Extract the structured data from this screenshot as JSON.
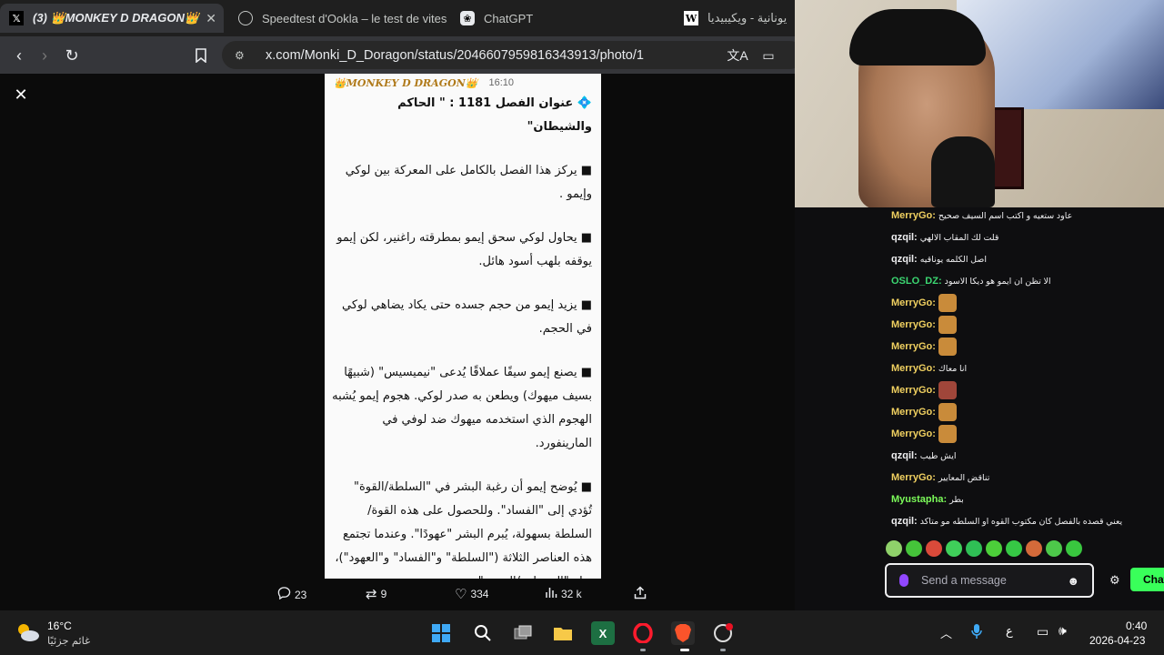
{
  "browser": {
    "tabs": [
      {
        "title": "(3) 👑MONKEY D DRAGON👑",
        "favicon": "x-logo-icon"
      },
      {
        "title": "Speedtest d'Ookla – le test de vitesse",
        "favicon": "speedtest-icon"
      },
      {
        "title": "ChatGPT",
        "favicon": "chatgpt-icon"
      },
      {
        "title": "يونانية - ويكيبيديا",
        "favicon": "wikipedia-icon"
      }
    ],
    "url": "x.com/Monki_D_Doragon/status/2046607959816343913/photo/1"
  },
  "photo": {
    "header_name": "👑MONKEY D DRAGON👑",
    "header_time": "16:10",
    "title": "💠 عنوان الفصل 1181 : \" الحاكم والشيطان\"",
    "paragraphs": [
      "■ يركز هذا الفصل بالكامل على المعركة بين لوكي وإيمو .",
      "■ يحاول لوكي سحق إيمو بمطرقته راغنير، لكن إيمو يوقفه بلهب أسود هائل.",
      "■ يزيد إيمو من حجم جسده حتى يكاد يضاهي لوكي في الحجم.",
      "■ يصنع إيمو سيفًا عملاقًا يُدعى \"نيميسيس\" (شبيهًا بسيف ميهوك) ويطعن به صدر لوكي. هجوم إيمو يُشبه الهجوم الذي استخدمه ميهوك ضد لوفي في المارينفورد.",
      "■ يُوضح إيمو أن رغبة البشر في \"السلطة/القوة\" تُؤدي إلى \"الفساد\". وللحصول على هذه القوة/ السلطة بسهولة، يُبرم البشر \"عهودًا\". وعندما تجتمع هذه العناصر الثلاثة (\"السلطة\" و\"الفساد\" و\"العهود\")، يولد \"السيطرة/الهيمنة\"."
    ]
  },
  "actions": {
    "replies": "23",
    "reposts": "9",
    "likes": "334",
    "views": "32 k"
  },
  "chat": {
    "messages": [
      {
        "user": "MerryGo:",
        "text": "عاود ستعيه و اكتب اسم السيف صحيح",
        "color": "#f0d060"
      },
      {
        "user": "qzqil:",
        "text": "قلت لك المقاب الالهي",
        "color": "#efeff1"
      },
      {
        "user": "qzqil:",
        "text": "اصل الكلمه يوناقيه",
        "color": "#efeff1"
      },
      {
        "user": "OSLO_DZ:",
        "text": "الا تظن ان ايمو هو ديكا الاسود",
        "color": "#3bd671"
      },
      {
        "user": "MerryGo:",
        "emote": "hand",
        "color": "#f0d060"
      },
      {
        "user": "MerryGo:",
        "emote": "hand",
        "color": "#f0d060"
      },
      {
        "user": "MerryGo:",
        "emote": "hand",
        "color": "#f0d060"
      },
      {
        "user": "MerryGo:",
        "text": "انا معاك",
        "color": "#f0d060"
      },
      {
        "user": "MerryGo:",
        "emote": "meat",
        "color": "#f0d060"
      },
      {
        "user": "MerryGo:",
        "emote": "hand",
        "color": "#f0d060"
      },
      {
        "user": "MerryGo:",
        "emote": "hand",
        "color": "#f0d060"
      },
      {
        "user": "qzqil:",
        "text": "ايش طيب",
        "color": "#efeff1"
      },
      {
        "user": "MerryGo:",
        "text": "تناقض المعايير",
        "color": "#f0d060"
      },
      {
        "user": "Myustapha:",
        "text": "بطر",
        "color": "#7cfc5a"
      },
      {
        "user": "qzqil:",
        "text": "يعني قصده بالفصل كان مكتوب القوه او السلطه مو متاكد",
        "color": "#efeff1"
      }
    ],
    "input_placeholder": "Send a message",
    "send_label": "Chat"
  },
  "taskbar": {
    "weather_temp": "16°C",
    "weather_desc": "غائم جزئيًا",
    "lang": "ع",
    "time": "0:40",
    "date": "2026-04-23"
  }
}
